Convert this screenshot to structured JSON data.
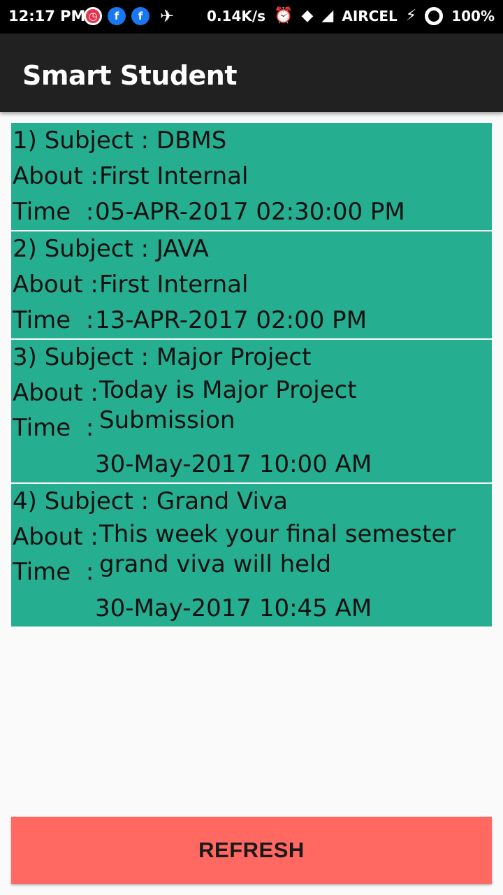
{
  "status_bar": {
    "time": "12:17 PM",
    "net_speed": "0.14K/s",
    "carrier": "AIRCEL",
    "battery": "100%",
    "icons": [
      "notification-app-icon",
      "facebook-icon",
      "facebook-icon",
      "plane-icon",
      "alarm-icon",
      "wifi-icon",
      "signal-icon",
      "charging-icon",
      "battery-icon"
    ]
  },
  "app_bar": {
    "title": "Smart Student"
  },
  "labels": {
    "subject": "Subject : ",
    "about": "About : ",
    "time": "Time  : "
  },
  "notices": [
    {
      "index": "1)",
      "subject": "DBMS",
      "about": "First Internal",
      "time": "05-APR-2017 02:30:00 PM"
    },
    {
      "index": "2)",
      "subject": "JAVA",
      "about": "First Internal",
      "time": "13-APR-2017 02:00 PM"
    },
    {
      "index": "3)",
      "subject": "Major Project",
      "about": "Today is Major Project Submission",
      "time": "30-May-2017 10:00 AM"
    },
    {
      "index": "4)",
      "subject": "Grand Viva",
      "about": "This week your final semester grand viva will held",
      "time": "30-May-2017 10:45 AM"
    }
  ],
  "refresh_label": "REFRESH",
  "colors": {
    "card_bg": "#26ae90",
    "button_bg": "#ff6961",
    "app_bar": "#212121"
  }
}
